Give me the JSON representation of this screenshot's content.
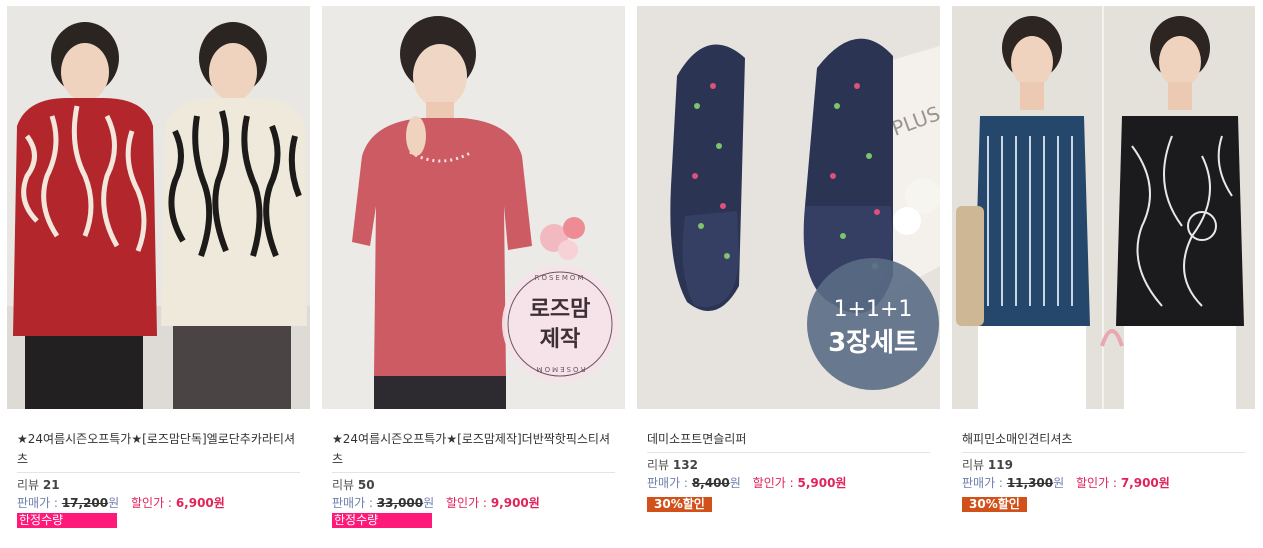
{
  "products": [
    {
      "name": "★24여름시즌오프특가★[로즈맘단독]엘로단추카라티셔츠",
      "review_label": "리뷰",
      "review_count": "21",
      "price_label": "판매가 :",
      "original_price": "17,200",
      "currency": "원",
      "sale_label": "할인가 :",
      "sale_price": "6,900원",
      "badge": "한정수량"
    },
    {
      "name": "★24여름시즌오프특가★[로즈맘제작]더반짝핫픽스티셔츠",
      "review_label": "리뷰",
      "review_count": "50",
      "price_label": "판매가 :",
      "original_price": "33,000",
      "currency": "원",
      "sale_label": "할인가 :",
      "sale_price": "9,900원",
      "badge": "한정수량",
      "image_text": {
        "ring_top": "ROSEMOM",
        "ring_bottom": "ROSEMOM",
        "line1": "로즈맘",
        "line2": "제작"
      }
    },
    {
      "name": "데미소프트면슬리퍼",
      "review_label": "리뷰",
      "review_count": "132",
      "price_label": "판매가 :",
      "original_price": "8,400",
      "currency": "원",
      "sale_label": "할인가 :",
      "sale_price": "5,900원",
      "badge": "30%할인",
      "image_text": {
        "line1": "1+1+1",
        "line2": "3장세트",
        "bg_text": "PLUS"
      }
    },
    {
      "name": "해피민소매인견티셔츠",
      "review_label": "리뷰",
      "review_count": "119",
      "price_label": "판매가 :",
      "original_price": "11,300",
      "currency": "원",
      "sale_label": "할인가 :",
      "sale_price": "7,900원",
      "badge": "30%할인"
    }
  ],
  "colors": {
    "price_label": "#6e7fae",
    "sale": "#e0245a",
    "limited_badge": "#ff1a7a",
    "discount_badge": "#d2511b"
  }
}
